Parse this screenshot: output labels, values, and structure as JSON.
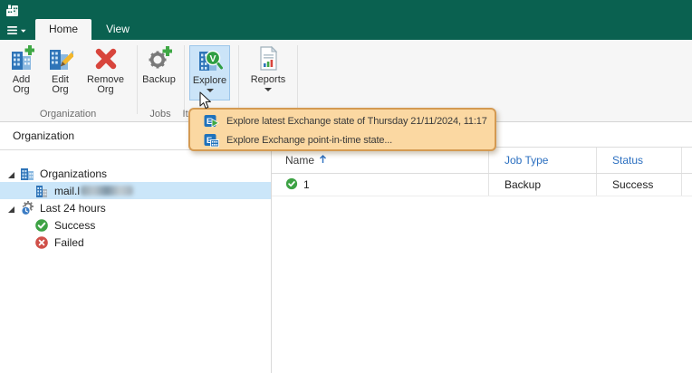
{
  "tabs": {
    "home": "Home",
    "view": "View"
  },
  "ribbon": {
    "buttons": {
      "add_org": "Add Org",
      "edit_org": "Edit Org",
      "remove_org": "Remove Org",
      "backup": "Backup",
      "explore": "Explore",
      "reports": "Reports"
    },
    "groups": {
      "organization": "Organization",
      "jobs": "Jobs",
      "item_restore": "Item Restore"
    }
  },
  "explore_menu": {
    "items": [
      {
        "icon": "exchange-latest-icon",
        "label": "Explore latest Exchange state of Thursday 21/11/2024, 11:17"
      },
      {
        "icon": "exchange-point-in-time-icon",
        "label": "Explore Exchange point-in-time state..."
      }
    ]
  },
  "sidebar": {
    "header": "Organization",
    "tree": [
      {
        "label": "Organizations",
        "level": 0,
        "expanded": true
      },
      {
        "label": "mail.l",
        "level": 1,
        "selected": true,
        "redacted": true
      },
      {
        "label": "Last 24 hours",
        "level": 0,
        "expanded": true
      },
      {
        "label": "Success",
        "level": 1
      },
      {
        "label": "Failed",
        "level": 1
      }
    ]
  },
  "grid": {
    "columns": [
      {
        "label": "Name",
        "sort": "asc"
      },
      {
        "label": "Job Type"
      },
      {
        "label": "Status"
      }
    ],
    "rows": [
      {
        "name": "1",
        "job_type": "Backup",
        "status": "Success"
      }
    ]
  },
  "colors": {
    "titlebar_green": "#0a6150",
    "menu_bg": "#fbd8a2",
    "menu_border": "#d49a52",
    "selection_blue": "#cbe6f9",
    "explore_highlight": "#cbe4f8",
    "header_link_blue": "#2b6fc0",
    "success_green": "#3da244",
    "failed_red": "#d05049"
  }
}
